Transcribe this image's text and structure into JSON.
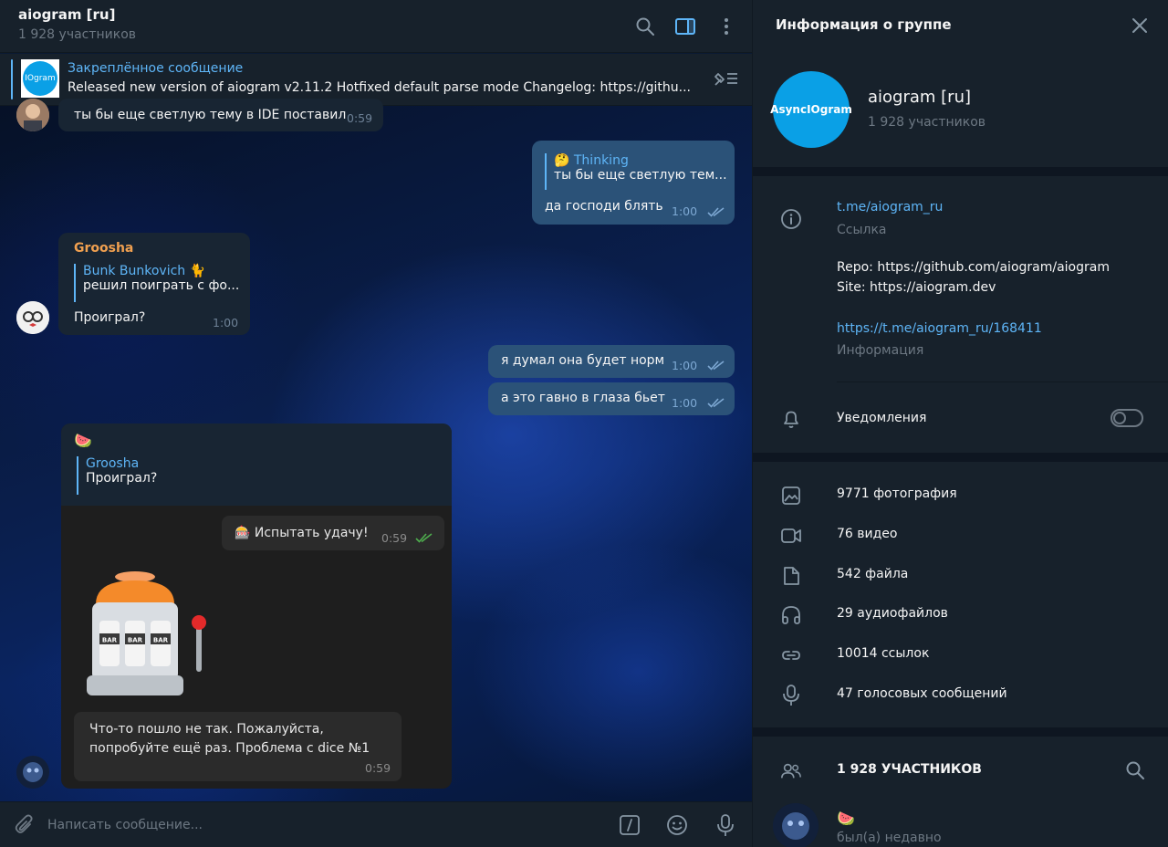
{
  "header": {
    "title": "aiogram [ru]",
    "subtitle": "1 928 участников"
  },
  "pinned": {
    "title": "Закреплённое сообщение",
    "text": "Released new version of aiogram v2.11.2  Hotfixed default parse mode  Changelog: https://githu..."
  },
  "messages": {
    "m1": {
      "text": "ты бы еще светлую тему в IDE поставил",
      "time": "0:59"
    },
    "m2": {
      "reply_name": "🤔 Thinking",
      "reply_text": "ты бы еще светлую тем...",
      "text": "да господи блять",
      "time": "1:00"
    },
    "m3": {
      "author": "Groosha",
      "reply_name": "Bunk Bunkovich 🐈",
      "reply_text": "решил поиграть с фо...",
      "text": "Проиграл?",
      "time": "1:00"
    },
    "m4": {
      "text": "я думал она будет норм",
      "time": "1:00"
    },
    "m5": {
      "text": "а это гавно в глаза бьет",
      "time": "1:00"
    },
    "m6": {
      "emoji": "🍉",
      "reply_name": "Groosha",
      "reply_text": "Проиграл?",
      "inner_button": "🎰 Испытать удачу!",
      "inner_time": "0:59",
      "slot_label_1": "BAR",
      "slot_label_2": "BAR",
      "slot_label_3": "BAR",
      "error_line1": "Что-то пошло не так. Пожалуйста,",
      "error_line2": "попробуйте ещё раз. Проблема с dice №1",
      "error_time": "0:59"
    }
  },
  "composer": {
    "placeholder": "Написать сообщение..."
  },
  "info": {
    "title": "Информация о группе",
    "group_name": "aiogram [ru]",
    "group_members": "1 928 участников",
    "avatar_text": "AsyncIOgram",
    "link": "t.me/aiogram_ru",
    "link_label": "Ссылка",
    "desc_line1": "Repo: https://github.com/aiogram/aiogram",
    "desc_line2": "Site: https://aiogram.dev",
    "desc_link": "https://t.me/aiogram_ru/168411",
    "desc_label": "Информация",
    "notifications": "Уведомления",
    "notifications_on": false,
    "media": {
      "photos": "9771 фотография",
      "videos": "76 видео",
      "files": "542 файла",
      "audio": "29 аудиофайлов",
      "links": "10014 ссылок",
      "voice": "47 голосовых сообщений"
    },
    "members_header": "1 928 УЧАСТНИКОВ",
    "member1_name": "🍉",
    "member1_status": "был(а) недавно"
  },
  "colors": {
    "accent": "#5eb5f7",
    "panel": "#17212b",
    "bubble_in": "#182533",
    "bubble_out": "#2b5278"
  }
}
